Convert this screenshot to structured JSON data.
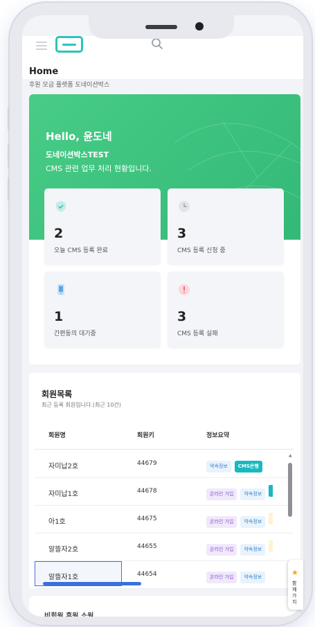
{
  "header": {
    "menu_icon": "hamburger-icon",
    "logo_icon": "cms-logo-icon",
    "search_icon": "search-icon"
  },
  "page": {
    "title": "Home",
    "breadcrumb": "후원 모금 플랫폼 도네이션박스"
  },
  "welcome": {
    "greeting": "Hello, 윤도네",
    "company": "도네이션박스TEST",
    "subtitle": "CMS 관련 업무 처리 현황입니다."
  },
  "stats": [
    {
      "icon": "shield-check-icon",
      "value": "2",
      "label": "오늘 CMS 등록 완료",
      "color": "#2bbfb3"
    },
    {
      "icon": "clock-icon",
      "value": "3",
      "label": "CMS 등록 신청 중",
      "color": "#b9bcc6"
    },
    {
      "icon": "mobile-phone-icon",
      "value": "1",
      "label": "간편동의 대기중",
      "color": "#5aa6e8"
    },
    {
      "icon": "alert-circle-icon",
      "value": "3",
      "label": "CMS 등록 실패",
      "color": "#f07a8a"
    }
  ],
  "members": {
    "title": "회원목록",
    "subtitle": "최근 등록 회원입니다.(최근 10건)",
    "columns": [
      "회원명",
      "회원키",
      "정보요약"
    ],
    "rows": [
      {
        "name": "자미납2호",
        "key": "44679",
        "tags": [
          {
            "text": "약속정보",
            "style": "blue"
          },
          {
            "text": "CMS은행",
            "style": "teal"
          }
        ]
      },
      {
        "name": "자미납1호",
        "key": "44678",
        "tags": [
          {
            "text": "온라인 가입",
            "style": "purple"
          },
          {
            "text": "약속정보",
            "style": "blue"
          }
        ]
      },
      {
        "name": "아1호",
        "key": "44675",
        "tags": [
          {
            "text": "온라인 가입",
            "style": "purple"
          },
          {
            "text": "약속정보",
            "style": "blue"
          }
        ]
      },
      {
        "name": "알뜰자2호",
        "key": "44655",
        "tags": [
          {
            "text": "온라인 가입",
            "style": "purple"
          },
          {
            "text": "약속정보",
            "style": "blue"
          }
        ]
      },
      {
        "name": "알뜰자1호",
        "key": "44654",
        "tags": [
          {
            "text": "온라인 가입",
            "style": "purple"
          },
          {
            "text": "약속정보",
            "style": "blue"
          }
        ]
      }
    ]
  },
  "bottom_section": {
    "title": "비회원 후원 소원"
  },
  "floating_widget": {
    "icon": "star-icon",
    "text": "함께가치"
  },
  "colors": {
    "banner_green": "#3fc47f",
    "accent_teal": "#2bc4b8",
    "selection_blue": "#3a6fe0"
  }
}
